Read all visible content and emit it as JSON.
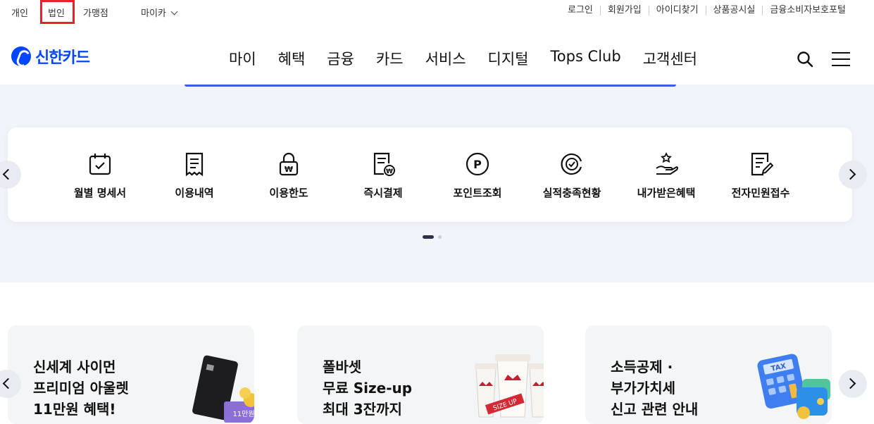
{
  "topbar": {
    "segments": [
      "개인",
      "법인",
      "가맹점",
      "마이카"
    ],
    "utility": [
      "로그인",
      "회원가입",
      "아이디찾기",
      "상품공시실",
      "금융소비자보호포털"
    ]
  },
  "header": {
    "logo_text": "신한카드",
    "nav": [
      "마이",
      "혜택",
      "금융",
      "카드",
      "서비스",
      "디지털",
      "Tops Club",
      "고객센터"
    ]
  },
  "quick_menu": [
    {
      "label": "월별 명세서",
      "icon": "calendar-check-icon"
    },
    {
      "label": "이용내역",
      "icon": "receipt-icon"
    },
    {
      "label": "이용한도",
      "icon": "lock-won-icon"
    },
    {
      "label": "즉시결제",
      "icon": "bill-pay-icon"
    },
    {
      "label": "포인트조회",
      "icon": "point-icon"
    },
    {
      "label": "실적충족현황",
      "icon": "target-check-icon"
    },
    {
      "label": "내가받은혜택",
      "icon": "hand-star-icon"
    },
    {
      "label": "전자민원접수",
      "icon": "document-edit-icon"
    }
  ],
  "promos": [
    {
      "lines": [
        "신세계 사이먼",
        "프리미엄 아울렛",
        "11만원 혜택!"
      ],
      "badge": "11만원"
    },
    {
      "lines": [
        "폴바셋",
        "무료 Size-up",
        "최대 3잔까지"
      ],
      "badge": "SIZE UP"
    },
    {
      "lines": [
        "소득공제 ·",
        "부가가치세",
        "신고 관련 안내"
      ],
      "badge": "TAX"
    }
  ],
  "colors": {
    "brand": "#0046ff",
    "highlight": "#e8212b",
    "hero_bg": "#f1f4fb"
  }
}
